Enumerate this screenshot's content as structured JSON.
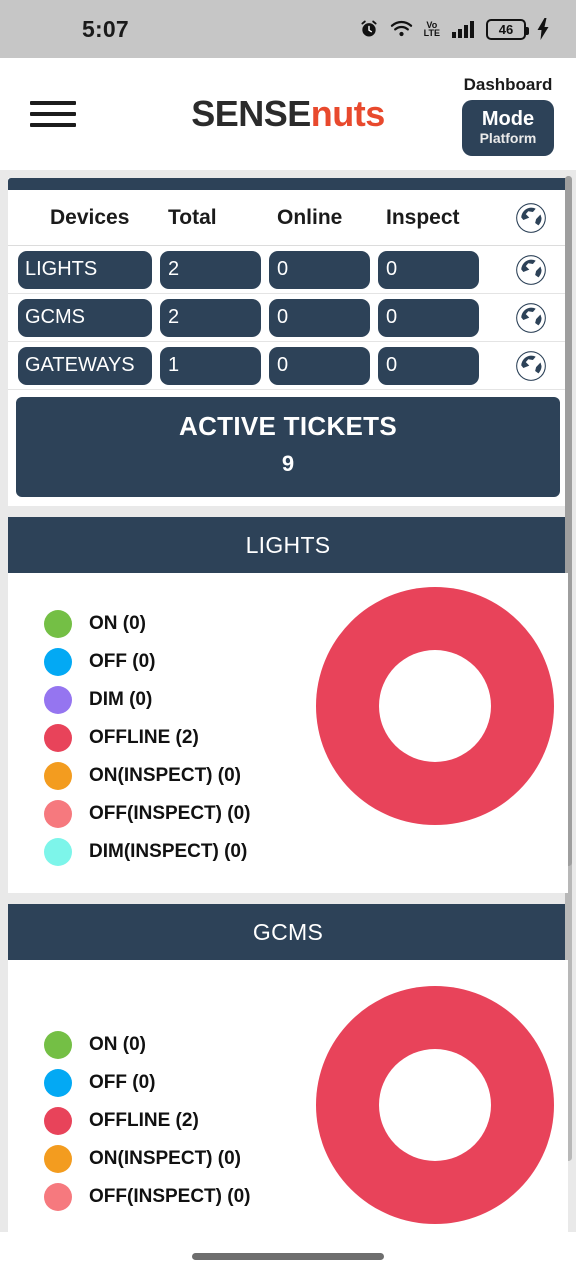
{
  "statusbar": {
    "time": "5:07",
    "battery_level": "46",
    "volte_top": "Vo",
    "volte_bottom": "LTE",
    "icons": [
      "alarm-icon",
      "wifi-icon",
      "volte-icon",
      "signal-icon",
      "battery-icon",
      "charging-bolt-icon"
    ]
  },
  "header": {
    "menu_icon": "hamburger-menu-icon",
    "logo_part1": "SENSE",
    "logo_part2": "nuts",
    "dashboard_label": "Dashboard",
    "mode_label": "Mode",
    "platform_label": "Platform"
  },
  "devices_table": {
    "columns": [
      "Devices",
      "Total",
      "Online",
      "Inspect"
    ],
    "rows": [
      {
        "name": "LIGHTS",
        "total": "2",
        "online": "0",
        "inspect": "0"
      },
      {
        "name": "GCMS",
        "total": "2",
        "online": "0",
        "inspect": "0"
      },
      {
        "name": "GATEWAYS",
        "total": "1",
        "online": "0",
        "inspect": "0"
      }
    ]
  },
  "tickets": {
    "title": "ACTIVE TICKETS",
    "count": "9"
  },
  "panels": [
    {
      "title": "LIGHTS",
      "legend": [
        {
          "label": "ON (0)",
          "color": "#74bf45"
        },
        {
          "label": "OFF (0)",
          "color": "#03a9f4"
        },
        {
          "label": "DIM (0)",
          "color": "#9575f0"
        },
        {
          "label": "OFFLINE (2)",
          "color": "#e8435a"
        },
        {
          "label": "ON(INSPECT) (0)",
          "color": "#f39c1f"
        },
        {
          "label": "OFF(INSPECT) (0)",
          "color": "#f6797e"
        },
        {
          "label": "DIM(INSPECT) (0)",
          "color": "#7df5ea"
        }
      ]
    },
    {
      "title": "GCMS",
      "legend": [
        {
          "label": "ON (0)",
          "color": "#74bf45"
        },
        {
          "label": "OFF (0)",
          "color": "#03a9f4"
        },
        {
          "label": "OFFLINE (2)",
          "color": "#e8435a"
        },
        {
          "label": "ON(INSPECT) (0)",
          "color": "#f39c1f"
        },
        {
          "label": "OFF(INSPECT) (0)",
          "color": "#f6797e"
        }
      ]
    }
  ],
  "chart_data": [
    {
      "type": "pie",
      "title": "LIGHTS",
      "labels": [
        "ON",
        "OFF",
        "DIM",
        "OFFLINE",
        "ON(INSPECT)",
        "OFF(INSPECT)",
        "DIM(INSPECT)"
      ],
      "values": [
        0,
        0,
        0,
        2,
        0,
        0,
        0
      ],
      "colors": [
        "#74bf45",
        "#03a9f4",
        "#9575f0",
        "#e8435a",
        "#f39c1f",
        "#f6797e",
        "#7df5ea"
      ],
      "donut": true,
      "legend_position": "left"
    },
    {
      "type": "pie",
      "title": "GCMS",
      "labels": [
        "ON",
        "OFF",
        "OFFLINE",
        "ON(INSPECT)",
        "OFF(INSPECT)"
      ],
      "values": [
        0,
        0,
        2,
        0,
        0
      ],
      "colors": [
        "#74bf45",
        "#03a9f4",
        "#e8435a",
        "#f39c1f",
        "#f6797e"
      ],
      "donut": true,
      "legend_position": "left"
    }
  ],
  "theme": {
    "navy": "#2d4258",
    "red": "#e8435a",
    "logo_orange": "#e8492d"
  }
}
